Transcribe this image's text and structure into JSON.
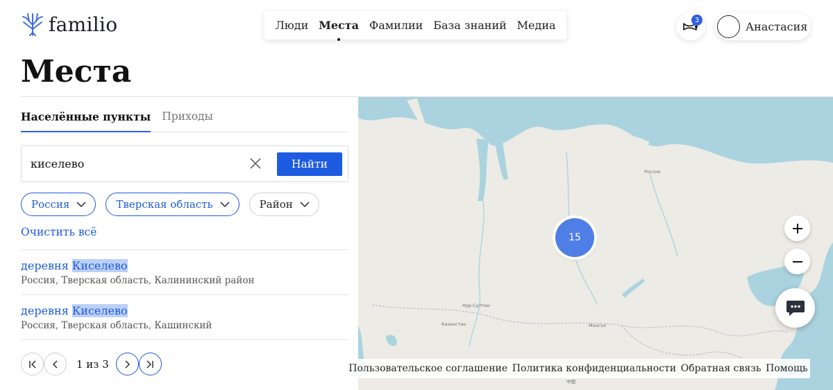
{
  "brand": {
    "name": "familio"
  },
  "nav": {
    "items": [
      {
        "label": "Люди",
        "active": false
      },
      {
        "label": "Места",
        "active": true
      },
      {
        "label": "Фамилии",
        "active": false
      },
      {
        "label": "База знаний",
        "active": false
      },
      {
        "label": "Медиа",
        "active": false
      }
    ]
  },
  "notifications": {
    "count": "3",
    "icon": "horn-icon"
  },
  "user": {
    "name": "Анастасия"
  },
  "page": {
    "title": "Места"
  },
  "tabs": [
    {
      "label": "Населённые пункты",
      "active": true
    },
    {
      "label": "Приходы",
      "active": false
    }
  ],
  "search": {
    "value": "киселево",
    "button": "Найти"
  },
  "filters": [
    {
      "label": "Россия",
      "selected": true
    },
    {
      "label": "Тверская область",
      "selected": true
    },
    {
      "label": "Район",
      "selected": false
    }
  ],
  "clear_all": "Очистить всё",
  "results": [
    {
      "type": "деревня",
      "name": "Киселево",
      "path": "Россия, Тверская область, Калининский район"
    },
    {
      "type": "деревня",
      "name": "Киселево",
      "path": "Россия, Тверская область, Кашинский"
    }
  ],
  "pagination": {
    "text": "1 из 3"
  },
  "map": {
    "cluster_count": "15",
    "labels": {
      "russia": "Россия",
      "kazakhstan": "Казахстан",
      "nur_sultan": "Нур-Султан",
      "mongolia": "Монгол",
      "china": "中国"
    }
  },
  "footer": {
    "links": [
      "Пользовательское соглашение",
      "Политика конфиденциальности",
      "Обратная связь",
      "Помощь"
    ]
  },
  "colors": {
    "accent": "#1d5be0",
    "cluster": "#4f7ee6",
    "water": "#aad3df",
    "land": "#ecebe5"
  }
}
